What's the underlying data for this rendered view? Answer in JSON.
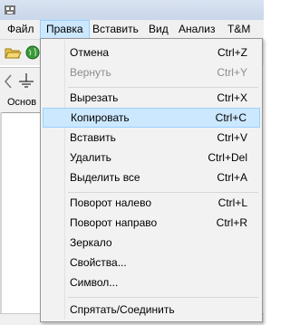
{
  "menubar": {
    "items": [
      {
        "label": "Файл"
      },
      {
        "label": "Правка"
      },
      {
        "label": "Вставить"
      },
      {
        "label": "Вид"
      },
      {
        "label": "Анализ"
      },
      {
        "label": "T&M"
      }
    ],
    "active": "Правка"
  },
  "tabs": {
    "label": "Основ"
  },
  "edit_menu": {
    "items": [
      {
        "label": "Отмена",
        "shortcut": "Ctrl+Z"
      },
      {
        "label": "Вернуть",
        "shortcut": "Ctrl+Y",
        "disabled": true
      },
      {
        "label": "Вырезать",
        "shortcut": "Ctrl+X"
      },
      {
        "label": "Копировать",
        "shortcut": "Ctrl+C",
        "highlighted": true
      },
      {
        "label": "Вставить",
        "shortcut": "Ctrl+V"
      },
      {
        "label": "Удалить",
        "shortcut": "Ctrl+Del"
      },
      {
        "label": "Выделить все",
        "shortcut": "Ctrl+A"
      },
      {
        "label": "Поворот налево",
        "shortcut": "Ctrl+L"
      },
      {
        "label": "Поворот направо",
        "shortcut": "Ctrl+R"
      },
      {
        "label": "Зеркало",
        "shortcut": ""
      },
      {
        "label": "Свойства...",
        "shortcut": ""
      },
      {
        "label": "Символ...",
        "shortcut": ""
      },
      {
        "label": "Спрятать/Соединить",
        "shortcut": ""
      }
    ]
  },
  "colors": {
    "highlight": "#cce8ff",
    "highlight_border": "#99d1ff",
    "menu_bg": "#f2f2f2"
  }
}
